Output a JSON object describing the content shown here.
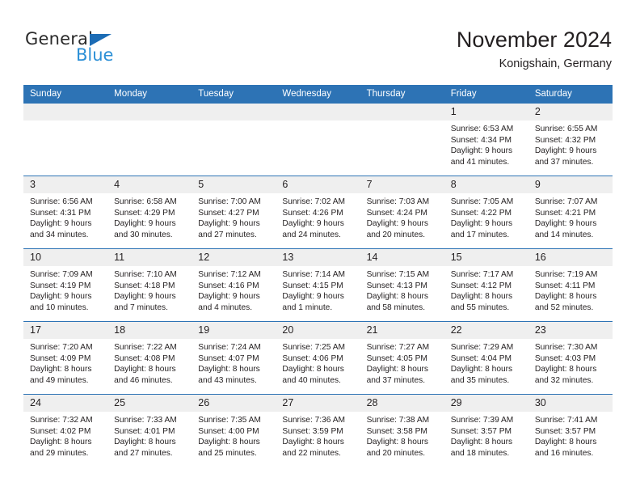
{
  "brand": {
    "name_top": "General",
    "name_bottom": "Blue",
    "color_dark": "#2b2b2b",
    "color_blue": "#2b8fd6",
    "triangle_color": "#1c6cb5"
  },
  "header": {
    "title": "November 2024",
    "subtitle": "Konigshain, Germany",
    "accent_color": "#2d73b5",
    "daynum_band_color": "#efefef"
  },
  "calendar": {
    "weekday_headers": [
      "Sunday",
      "Monday",
      "Tuesday",
      "Wednesday",
      "Thursday",
      "Friday",
      "Saturday"
    ],
    "weeks": [
      [
        {
          "day": "",
          "empty": true
        },
        {
          "day": "",
          "empty": true
        },
        {
          "day": "",
          "empty": true
        },
        {
          "day": "",
          "empty": true
        },
        {
          "day": "",
          "empty": true
        },
        {
          "day": "1",
          "sunrise": "Sunrise: 6:53 AM",
          "sunset": "Sunset: 4:34 PM",
          "daylight": "Daylight: 9 hours and 41 minutes."
        },
        {
          "day": "2",
          "sunrise": "Sunrise: 6:55 AM",
          "sunset": "Sunset: 4:32 PM",
          "daylight": "Daylight: 9 hours and 37 minutes."
        }
      ],
      [
        {
          "day": "3",
          "sunrise": "Sunrise: 6:56 AM",
          "sunset": "Sunset: 4:31 PM",
          "daylight": "Daylight: 9 hours and 34 minutes."
        },
        {
          "day": "4",
          "sunrise": "Sunrise: 6:58 AM",
          "sunset": "Sunset: 4:29 PM",
          "daylight": "Daylight: 9 hours and 30 minutes."
        },
        {
          "day": "5",
          "sunrise": "Sunrise: 7:00 AM",
          "sunset": "Sunset: 4:27 PM",
          "daylight": "Daylight: 9 hours and 27 minutes."
        },
        {
          "day": "6",
          "sunrise": "Sunrise: 7:02 AM",
          "sunset": "Sunset: 4:26 PM",
          "daylight": "Daylight: 9 hours and 24 minutes."
        },
        {
          "day": "7",
          "sunrise": "Sunrise: 7:03 AM",
          "sunset": "Sunset: 4:24 PM",
          "daylight": "Daylight: 9 hours and 20 minutes."
        },
        {
          "day": "8",
          "sunrise": "Sunrise: 7:05 AM",
          "sunset": "Sunset: 4:22 PM",
          "daylight": "Daylight: 9 hours and 17 minutes."
        },
        {
          "day": "9",
          "sunrise": "Sunrise: 7:07 AM",
          "sunset": "Sunset: 4:21 PM",
          "daylight": "Daylight: 9 hours and 14 minutes."
        }
      ],
      [
        {
          "day": "10",
          "sunrise": "Sunrise: 7:09 AM",
          "sunset": "Sunset: 4:19 PM",
          "daylight": "Daylight: 9 hours and 10 minutes."
        },
        {
          "day": "11",
          "sunrise": "Sunrise: 7:10 AM",
          "sunset": "Sunset: 4:18 PM",
          "daylight": "Daylight: 9 hours and 7 minutes."
        },
        {
          "day": "12",
          "sunrise": "Sunrise: 7:12 AM",
          "sunset": "Sunset: 4:16 PM",
          "daylight": "Daylight: 9 hours and 4 minutes."
        },
        {
          "day": "13",
          "sunrise": "Sunrise: 7:14 AM",
          "sunset": "Sunset: 4:15 PM",
          "daylight": "Daylight: 9 hours and 1 minute."
        },
        {
          "day": "14",
          "sunrise": "Sunrise: 7:15 AM",
          "sunset": "Sunset: 4:13 PM",
          "daylight": "Daylight: 8 hours and 58 minutes."
        },
        {
          "day": "15",
          "sunrise": "Sunrise: 7:17 AM",
          "sunset": "Sunset: 4:12 PM",
          "daylight": "Daylight: 8 hours and 55 minutes."
        },
        {
          "day": "16",
          "sunrise": "Sunrise: 7:19 AM",
          "sunset": "Sunset: 4:11 PM",
          "daylight": "Daylight: 8 hours and 52 minutes."
        }
      ],
      [
        {
          "day": "17",
          "sunrise": "Sunrise: 7:20 AM",
          "sunset": "Sunset: 4:09 PM",
          "daylight": "Daylight: 8 hours and 49 minutes."
        },
        {
          "day": "18",
          "sunrise": "Sunrise: 7:22 AM",
          "sunset": "Sunset: 4:08 PM",
          "daylight": "Daylight: 8 hours and 46 minutes."
        },
        {
          "day": "19",
          "sunrise": "Sunrise: 7:24 AM",
          "sunset": "Sunset: 4:07 PM",
          "daylight": "Daylight: 8 hours and 43 minutes."
        },
        {
          "day": "20",
          "sunrise": "Sunrise: 7:25 AM",
          "sunset": "Sunset: 4:06 PM",
          "daylight": "Daylight: 8 hours and 40 minutes."
        },
        {
          "day": "21",
          "sunrise": "Sunrise: 7:27 AM",
          "sunset": "Sunset: 4:05 PM",
          "daylight": "Daylight: 8 hours and 37 minutes."
        },
        {
          "day": "22",
          "sunrise": "Sunrise: 7:29 AM",
          "sunset": "Sunset: 4:04 PM",
          "daylight": "Daylight: 8 hours and 35 minutes."
        },
        {
          "day": "23",
          "sunrise": "Sunrise: 7:30 AM",
          "sunset": "Sunset: 4:03 PM",
          "daylight": "Daylight: 8 hours and 32 minutes."
        }
      ],
      [
        {
          "day": "24",
          "sunrise": "Sunrise: 7:32 AM",
          "sunset": "Sunset: 4:02 PM",
          "daylight": "Daylight: 8 hours and 29 minutes."
        },
        {
          "day": "25",
          "sunrise": "Sunrise: 7:33 AM",
          "sunset": "Sunset: 4:01 PM",
          "daylight": "Daylight: 8 hours and 27 minutes."
        },
        {
          "day": "26",
          "sunrise": "Sunrise: 7:35 AM",
          "sunset": "Sunset: 4:00 PM",
          "daylight": "Daylight: 8 hours and 25 minutes."
        },
        {
          "day": "27",
          "sunrise": "Sunrise: 7:36 AM",
          "sunset": "Sunset: 3:59 PM",
          "daylight": "Daylight: 8 hours and 22 minutes."
        },
        {
          "day": "28",
          "sunrise": "Sunrise: 7:38 AM",
          "sunset": "Sunset: 3:58 PM",
          "daylight": "Daylight: 8 hours and 20 minutes."
        },
        {
          "day": "29",
          "sunrise": "Sunrise: 7:39 AM",
          "sunset": "Sunset: 3:57 PM",
          "daylight": "Daylight: 8 hours and 18 minutes."
        },
        {
          "day": "30",
          "sunrise": "Sunrise: 7:41 AM",
          "sunset": "Sunset: 3:57 PM",
          "daylight": "Daylight: 8 hours and 16 minutes."
        }
      ]
    ]
  }
}
